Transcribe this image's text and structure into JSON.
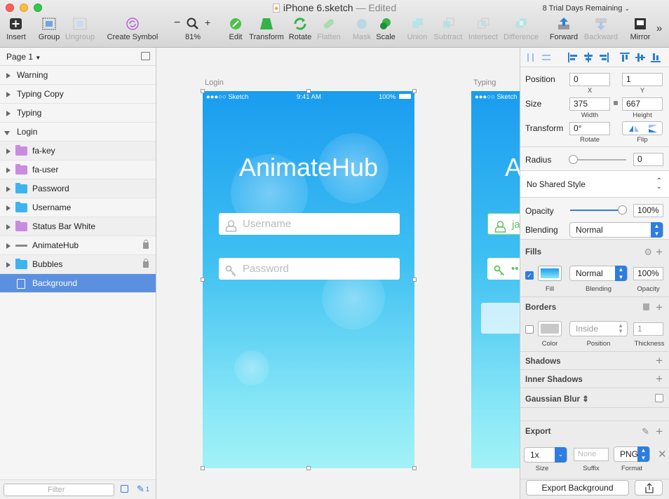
{
  "window": {
    "title": "iPhone 6.sketch",
    "status": "— Edited",
    "trial": "8 Trial Days Remaining"
  },
  "toolbar": {
    "insert": "Insert",
    "group": "Group",
    "ungroup": "Ungroup",
    "create_symbol": "Create Symbol",
    "zoom": "81%",
    "zoom_minus": "−",
    "zoom_plus": "+",
    "edit": "Edit",
    "transform": "Transform",
    "rotate": "Rotate",
    "flatten": "Flatten",
    "mask": "Mask",
    "scale": "Scale",
    "union": "Union",
    "subtract": "Subtract",
    "intersect": "Intersect",
    "difference": "Difference",
    "forward": "Forward",
    "backward": "Backward",
    "mirror": "Mirror",
    "more": "»"
  },
  "layers": {
    "page": "Page 1",
    "items": [
      {
        "label": "Warning"
      },
      {
        "label": "Typing Copy"
      },
      {
        "label": "Typing"
      },
      {
        "label": "Login"
      },
      {
        "label": "fa-key"
      },
      {
        "label": "fa-user"
      },
      {
        "label": "Password"
      },
      {
        "label": "Username"
      },
      {
        "label": "Status Bar White"
      },
      {
        "label": "AnimateHub"
      },
      {
        "label": "Bubbles"
      },
      {
        "label": "Background"
      }
    ],
    "filter_placeholder": "Filter",
    "badge_count": "1"
  },
  "canvas": {
    "artboard_login_label": "Login",
    "artboard_typing_label": "Typing",
    "status_carrier": "●●●○○ Sketch",
    "status_time": "9:41 AM",
    "status_battery": "100%",
    "app_title": "AnimateHub",
    "username_placeholder": "Username",
    "password_placeholder": "Password",
    "typing_title_partial": "A",
    "typing_field_partial": "ja",
    "typing_dots": "••"
  },
  "inspector": {
    "position_label": "Position",
    "pos_x": "0",
    "pos_y": "1",
    "x_label": "X",
    "y_label": "Y",
    "size_label": "Size",
    "width": "375",
    "height": "667",
    "width_label": "Width",
    "height_label": "Height",
    "transform_label": "Transform",
    "rotate_value": "0°",
    "rotate_label": "Rotate",
    "flip_label": "Flip",
    "radius_label": "Radius",
    "radius_value": "0",
    "shared_style": "No Shared Style",
    "opacity_label": "Opacity",
    "opacity_value": "100%",
    "opacity_level": 1.0,
    "blending_label": "Blending",
    "blending_value": "Normal",
    "fills_label": "Fills",
    "fill_blending": "Normal",
    "fill_opacity": "100%",
    "fill_sub": "Fill",
    "fill_blend_sub": "Blending",
    "fill_opacity_sub": "Opacity",
    "borders_label": "Borders",
    "border_position": "Inside",
    "border_thickness": "1",
    "border_color_sub": "Color",
    "border_position_sub": "Position",
    "border_thickness_sub": "Thickness",
    "shadows_label": "Shadows",
    "inner_shadows_label": "Inner Shadows",
    "blur_label": "Gaussian Blur ⇕",
    "export_label": "Export",
    "export_size": "1x",
    "export_suffix_placeholder": "None",
    "export_format": "PNG",
    "size_sub": "Size",
    "suffix_sub": "Suffix",
    "format_sub": "Format",
    "export_button": "Export Background"
  },
  "colors": {
    "accent": "#2e7de0",
    "selection": "#5b8fe0",
    "folder_purple": "#c98be0",
    "folder_blue": "#3fb3f0",
    "artboard_top": "#1a9cf0",
    "artboard_bottom": "#a2f2f6"
  }
}
